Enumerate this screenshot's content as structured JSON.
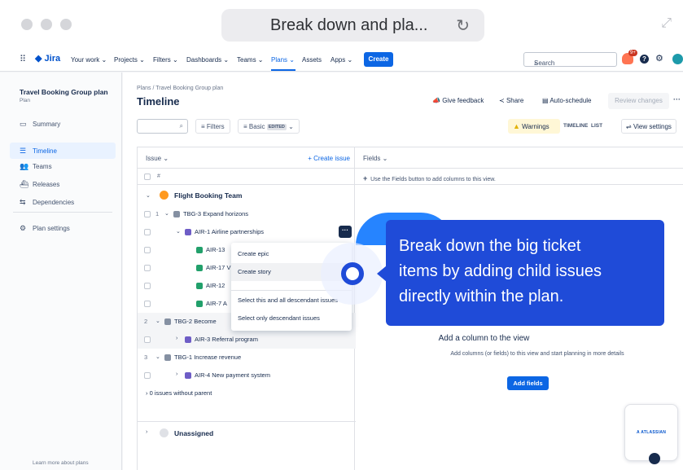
{
  "browser": {
    "url": "Break down and pla...",
    "reload_icon": "reload-icon",
    "expand_icon": "expand-icon"
  },
  "nav": {
    "logo": "Jira",
    "items": [
      "Your work",
      "Projects",
      "Filters",
      "Dashboards",
      "Teams",
      "Plans",
      "Assets",
      "Apps"
    ],
    "active_item": "Plans",
    "create_label": "Create",
    "search_placeholder": "Search",
    "notifications_badge": "9+",
    "help_label": "?"
  },
  "sidebar": {
    "plan_title": "Travel Booking Group plan",
    "plan_subtitle": "Plan",
    "items": [
      {
        "label": "Summary",
        "icon": "summary-icon"
      },
      {
        "label": "Timeline",
        "icon": "timeline-icon",
        "active": true
      },
      {
        "label": "Teams",
        "icon": "teams-icon"
      },
      {
        "label": "Releases",
        "icon": "releases-icon"
      },
      {
        "label": "Dependencies",
        "icon": "dependencies-icon"
      }
    ],
    "settings_label": "Plan settings",
    "learn_more": "Learn more about plans"
  },
  "header": {
    "breadcrumb": "Plans / Travel Booking Group plan",
    "title": "Timeline",
    "give_feedback": "Give feedback",
    "share": "Share",
    "auto_schedule": "Auto-schedule",
    "review_changes": "Review changes",
    "more": "···"
  },
  "toolbar": {
    "filters": "Filters",
    "basic": "Basic",
    "edited": "EDITED",
    "warnings": "Warnings",
    "timeline_tab": "TIMELINE",
    "list_tab": "LIST",
    "view_settings": "View settings"
  },
  "grid": {
    "issue_header": "Issue",
    "create_issue": "+ Create issue",
    "hash": "#",
    "fields_header": "Fields",
    "fields_hint": "Use the Fields button to add columns to this view.",
    "rows": [
      {
        "type": "team",
        "label": "Flight Booking Team"
      },
      {
        "num": "1",
        "key": "TBG-3",
        "summary": "Expand horizons"
      },
      {
        "key": "AIR-1",
        "summary": "Airline partnerships"
      },
      {
        "key": "AIR-13",
        "summary": ""
      },
      {
        "key": "AIR-17",
        "summary": "V"
      },
      {
        "key": "AIR-12",
        "summary": ""
      },
      {
        "key": "AIR-7",
        "summary": "A"
      },
      {
        "num": "2",
        "key": "TBG-2",
        "summary": "Become"
      },
      {
        "key": "AIR-3",
        "summary": "Referral program"
      },
      {
        "num": "3",
        "key": "TBG-1",
        "summary": "Increase revenue"
      },
      {
        "key": "AIR-4",
        "summary": "New payment system"
      }
    ],
    "no_parent": "0 issues without parent",
    "unassigned": "Unassigned"
  },
  "context_menu": {
    "items": [
      "Create epic",
      "Create story",
      "Select this and all descendant issues",
      "Select only descendant issues"
    ]
  },
  "empty_state": {
    "title": "Add a column to the view",
    "subtitle": "Add columns (or fields) to this view and start planning in more details",
    "button": "Add fields"
  },
  "spotlight": {
    "text": "Break down the big ticket\nitems by adding child issues\ndirectly within the plan."
  },
  "atlassian_badge": "A ATLASSIAN",
  "colors": {
    "accent": "#0c66e4",
    "spotlight": "#1f4bd8",
    "epic": "#6e5dc6",
    "story": "#22a06b"
  }
}
